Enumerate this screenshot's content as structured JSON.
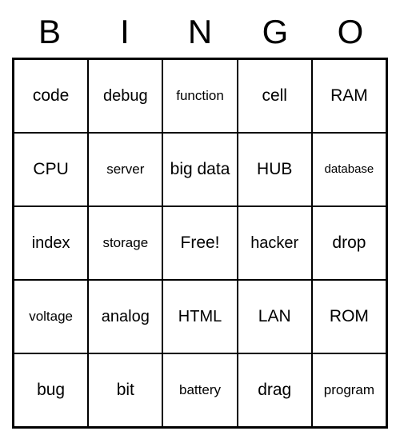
{
  "header": [
    "B",
    "I",
    "N",
    "G",
    "O"
  ],
  "grid": [
    [
      {
        "text": "code",
        "size": ""
      },
      {
        "text": "debug",
        "size": "medium"
      },
      {
        "text": "function",
        "size": "small"
      },
      {
        "text": "cell",
        "size": ""
      },
      {
        "text": "RAM",
        "size": ""
      }
    ],
    [
      {
        "text": "CPU",
        "size": ""
      },
      {
        "text": "server",
        "size": "small"
      },
      {
        "text": "big data",
        "size": ""
      },
      {
        "text": "HUB",
        "size": ""
      },
      {
        "text": "database",
        "size": "xsmall"
      }
    ],
    [
      {
        "text": "index",
        "size": "medium"
      },
      {
        "text": "storage",
        "size": "small"
      },
      {
        "text": "Free!",
        "size": ""
      },
      {
        "text": "hacker",
        "size": "medium"
      },
      {
        "text": "drop",
        "size": ""
      }
    ],
    [
      {
        "text": "voltage",
        "size": "small"
      },
      {
        "text": "analog",
        "size": "medium"
      },
      {
        "text": "HTML",
        "size": "medium"
      },
      {
        "text": "LAN",
        "size": ""
      },
      {
        "text": "ROM",
        "size": ""
      }
    ],
    [
      {
        "text": "bug",
        "size": ""
      },
      {
        "text": "bit",
        "size": ""
      },
      {
        "text": "battery",
        "size": "small"
      },
      {
        "text": "drag",
        "size": ""
      },
      {
        "text": "program",
        "size": "small"
      }
    ]
  ]
}
